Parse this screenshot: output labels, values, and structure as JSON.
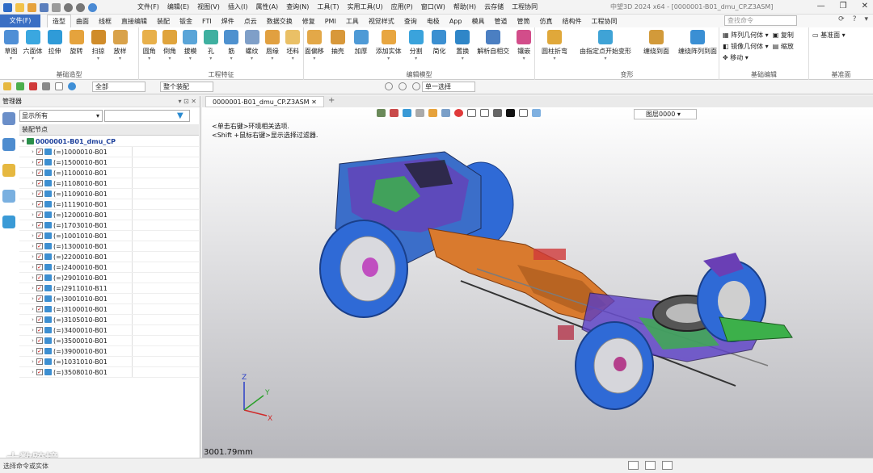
{
  "window": {
    "menus": [
      "文件(F)",
      "编辑(E)",
      "视图(V)",
      "插入(I)",
      "属性(A)",
      "查询(N)",
      "工具(T)",
      "实用工具(U)",
      "应用(P)",
      "窗口(W)",
      "帮助(H)",
      "云存储",
      "工程协同"
    ],
    "title": "中望3D 2024 x64 - [0000001-B01_dmu_CP.Z3ASM]"
  },
  "ribbon_tabs": [
    "造型",
    "曲面",
    "线框",
    "直接编辑",
    "装配",
    "钣金",
    "FTI",
    "焊件",
    "点云",
    "数据交换",
    "修复",
    "PMI",
    "工具",
    "视觉样式",
    "查询",
    "电极",
    "App",
    "模具",
    "管道",
    "管筒",
    "仿真",
    "结构件",
    "工程协同"
  ],
  "file_tab": "文件(F)",
  "search_placeholder": "查找命令",
  "ribbon_groups": [
    {
      "label": "基础造型",
      "buttons": [
        "草图",
        "六面体",
        "拉伸",
        "旋转",
        "扫掠",
        "放样"
      ]
    },
    {
      "label": "工程特征",
      "buttons": [
        "圆角",
        "倒角",
        "拔模",
        "孔",
        "筋",
        "螺纹",
        "唇缘",
        "坯料"
      ]
    },
    {
      "label": "编辑模型",
      "buttons": [
        "面偏移",
        "抽壳",
        "加厚",
        "添加实体",
        "分割",
        "简化",
        "置换",
        "解析自相交",
        "镶嵌"
      ]
    },
    {
      "label": "变形",
      "buttons": [
        "圆柱折弯",
        "由指定点开始变形",
        "缠绕到面",
        "缠绕阵列到面"
      ]
    },
    {
      "label": "基础编辑",
      "small": [
        "阵列几何体",
        "复制",
        "镜像几何体",
        "缩放",
        "移动"
      ]
    },
    {
      "label": "基准面",
      "small": [
        "基准面"
      ]
    }
  ],
  "toolbar2": {
    "filter_all": "全部",
    "assembly_mode": "整个装配",
    "select_mode": "单一选择"
  },
  "manager": {
    "title": "管理器",
    "show_filter": "显示所有",
    "tree_header": "装配节点",
    "root": "0000001-B01_dmu_CP",
    "nodes": [
      "(=)1000010-B01",
      "(=)1500010-B01",
      "(=)1100010-B01",
      "(=)1108010-B01",
      "(=)1109010-B01",
      "(=)1119010-B01",
      "(=)1200010-B01",
      "(=)1703010-B01",
      "(=)1001010-B01",
      "(=)1300010-B01",
      "(=)2200010-B01",
      "(=)2400010-B01",
      "(=)2901010-B01",
      "(=)2911010-B11",
      "(=)3001010-B01",
      "(=)3100010-B01",
      "(=)3105010-B01",
      "(=)3400010-B01",
      "(=)3500010-B01",
      "(=)3900010-B01",
      "(=)1031010-B01",
      "(=)3508010-B01"
    ]
  },
  "viewport": {
    "doc_tab": "0000001-B01_dmu_CP.Z3ASM",
    "hint1": "<单击右键>环境相关选项.",
    "hint2": "<Shift +鼠标右键>显示选择过滤器.",
    "layer": "图层0000",
    "scale": "3001.79mm",
    "axis_labels": {
      "x": "X",
      "y": "Y",
      "z": "Z"
    }
  },
  "status": {
    "message": "选择命令或实体"
  },
  "watermark": "大数跨境",
  "colors": {
    "file_tab": "#3a6fc4",
    "tire": "#2f6ad6",
    "frame_orange": "#d97a2e",
    "purple": "#7a3fc7",
    "green": "#3cb04a"
  }
}
